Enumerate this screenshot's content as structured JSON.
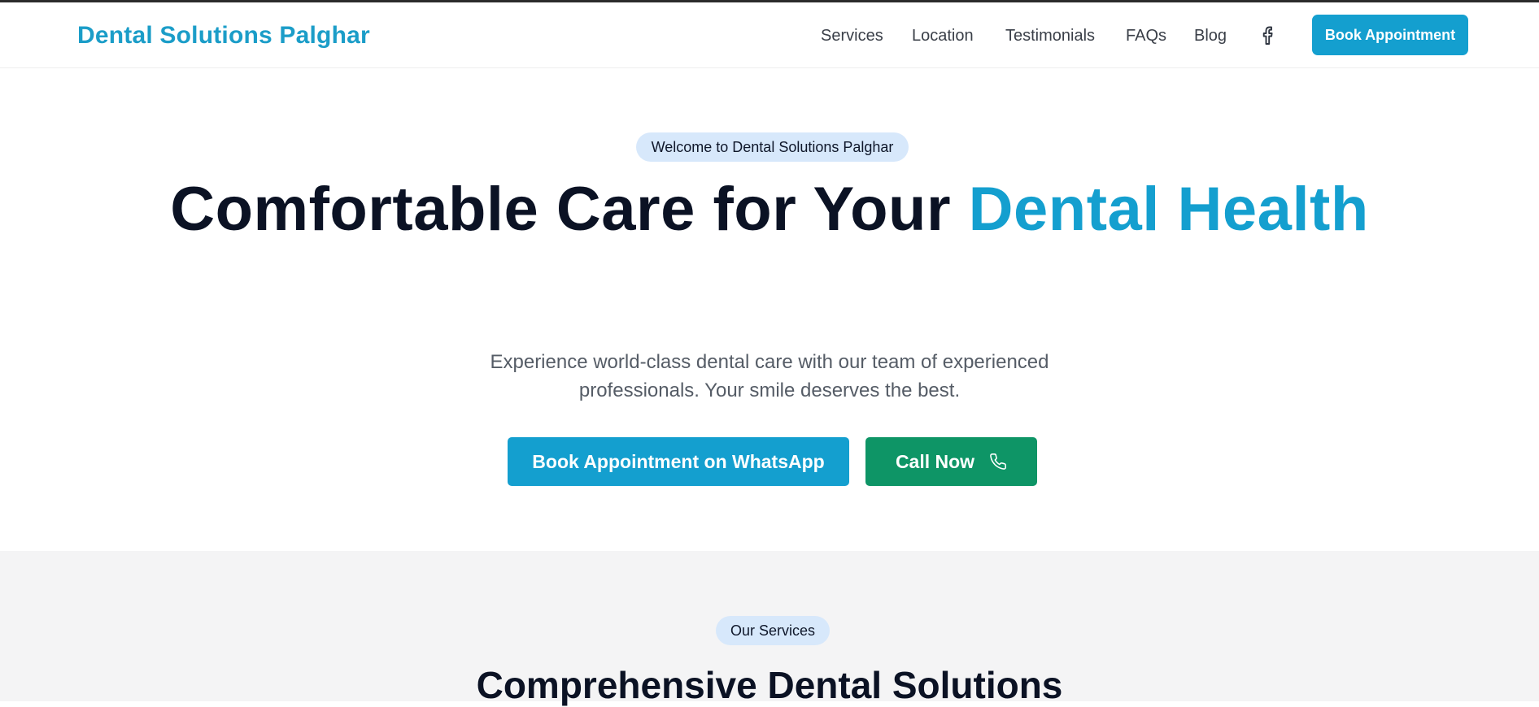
{
  "header": {
    "brand": "Dental Solutions Palghar",
    "nav": [
      "Services",
      "Location",
      "Testimonials",
      "FAQs",
      "Blog"
    ],
    "social_icon": "facebook-icon",
    "cta_label": "Book Appointment"
  },
  "hero": {
    "badge": "Welcome to Dental Solutions Palghar",
    "title_main": "Comfortable Care for Your ",
    "title_accent": "Dental Health",
    "subtitle": "Experience world-class dental care with our team of experienced professionals. Your smile deserves the best.",
    "whatsapp_button": "Book Appointment on WhatsApp",
    "call_button": "Call Now",
    "call_icon": "phone-icon"
  },
  "services": {
    "badge": "Our Services",
    "title": "Comprehensive Dental Solutions"
  },
  "colors": {
    "brand": "#149fcf",
    "call_green": "#0e9566",
    "pill_bg": "#d7e8fb",
    "heading": "#0b1224"
  }
}
